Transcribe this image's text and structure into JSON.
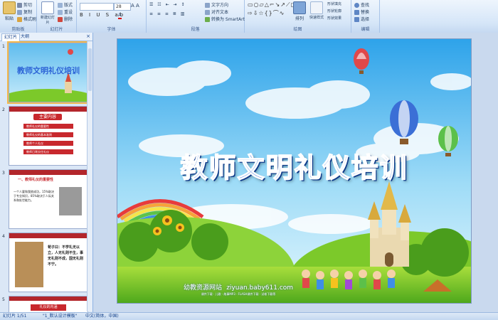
{
  "ribbon": {
    "clipboard": {
      "label": "剪贴板",
      "paste": "粘贴",
      "cut": "剪切",
      "copy": "复制",
      "format_painter": "格式刷"
    },
    "slides": {
      "label": "幻灯片",
      "new_slide": "新建幻灯片",
      "layout": "版式",
      "reset": "重设",
      "delete": "删除"
    },
    "font": {
      "label": "字体",
      "size": "28"
    },
    "paragraph": {
      "label": "段落",
      "text_direction": "文字方向",
      "align_text": "对齐文本",
      "smartart": "转换为 SmartArt"
    },
    "drawing": {
      "label": "绘图",
      "arrange": "排列",
      "quick_styles": "快速样式",
      "shape_fill": "形状填充",
      "shape_outline": "形状轮廓",
      "shape_effects": "形状效果"
    },
    "editing": {
      "label": "编辑",
      "find": "查找",
      "replace": "替换",
      "select": "选择"
    }
  },
  "panel": {
    "tab_slides": "幻灯片",
    "tab_outline": "大纲",
    "close": "×",
    "thumbs": [
      {
        "num": "1",
        "title": "教师文明礼仪培训"
      },
      {
        "num": "2",
        "title": "主要内容",
        "items": [
          "教师礼仪的重要性",
          "教师礼仪的基本准则",
          "教师个人礼仪",
          "教师日常交往礼仪"
        ]
      },
      {
        "num": "3",
        "heading": "一、教师礼仪的重要性",
        "text": "一个人要和我欲成功，15%取决于专业知识，85%取决于人际关系和处世能力。"
      },
      {
        "num": "4",
        "text": "荀子曰：不学礼无以立，人无礼则不生，事无礼则不成，国无礼则不宁。"
      },
      {
        "num": "5",
        "caption": "礼仪的内涵"
      }
    ]
  },
  "slide": {
    "title": "教师文明礼仪培训",
    "watermark_cn": "幼教资源网站",
    "watermark_url": "ziyuan.baby611.com",
    "watermark_small": "课件下载 · 儿歌 · 故事MP3 · FLASH课件下载 · 试卷下载等"
  },
  "status": {
    "slide_info": "幻灯片 1/51",
    "theme": "\"1_默认设计模板\"",
    "language": "中文(简体，中国)"
  },
  "colors": {
    "title_fill": "#1e5fd6",
    "title_outline": "#ffffff",
    "sky_top": "#6cc5f2",
    "grass": "#7cc92a",
    "selected_border": "#f2b84b"
  }
}
